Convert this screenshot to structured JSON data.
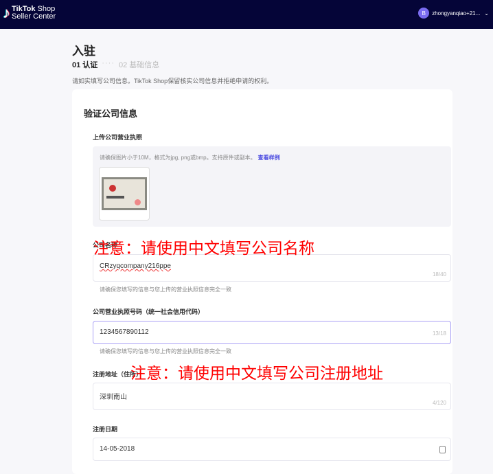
{
  "header": {
    "brand_bold": "TikTok",
    "brand_rest": " Shop",
    "brand_sub": "Seller Center",
    "user": "zhongyanqiao+21...",
    "avatar_letter": "B"
  },
  "page": {
    "title": "入驻",
    "step1": "01 认证",
    "step_sep": "····",
    "step2": "02 基础信息",
    "description": "请如实填写公司信息。TikTok Shop保留核实公司信息并拒绝申请的权利。"
  },
  "card": {
    "title": "验证公司信息",
    "upload": {
      "label": "上传公司营业执照",
      "hint": "请确保图片小于10M，格式为jpg, png或bmp。支持原件或副本。",
      "sample_link": "查看样例"
    },
    "company_name": {
      "label": "公司名称",
      "value": "CRzyqcompany216ppe",
      "count": "18/40",
      "help": "请确保您填写的信息与您上传的营业执照信息完全一致"
    },
    "license_no": {
      "label": "公司营业执照号码（统一社会信用代码）",
      "value": "1234567890112",
      "count": "13/18",
      "help": "请确保您填写的信息与您上传的营业执照信息完全一致"
    },
    "address": {
      "label": "注册地址（住所）",
      "value": "深圳南山",
      "count": "4/120"
    },
    "reg_date": {
      "label": "注册日期",
      "value": "14-05-2018"
    }
  },
  "annotations": {
    "name_note": "注意：请使用中文填写公司名称",
    "address_note": "注意：请使用中文填写公司注册地址"
  }
}
